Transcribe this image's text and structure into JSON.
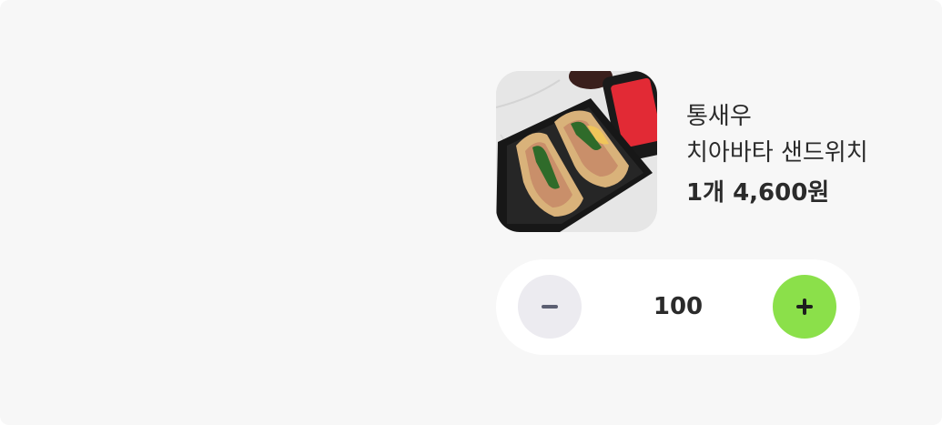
{
  "product": {
    "name": "통새우\n치아바타 샌드위치",
    "price": "1개 4,600원",
    "image_icon": "sandwich-photo"
  },
  "stepper": {
    "quantity": "100",
    "decrement_icon": "minus-icon",
    "increment_icon": "plus-icon"
  },
  "colors": {
    "background": "#f7f7f7",
    "stepper_bg": "#ffffff",
    "minus_button": "#ecebf0",
    "plus_button": "#8be04a",
    "text": "#2b2b2b"
  }
}
